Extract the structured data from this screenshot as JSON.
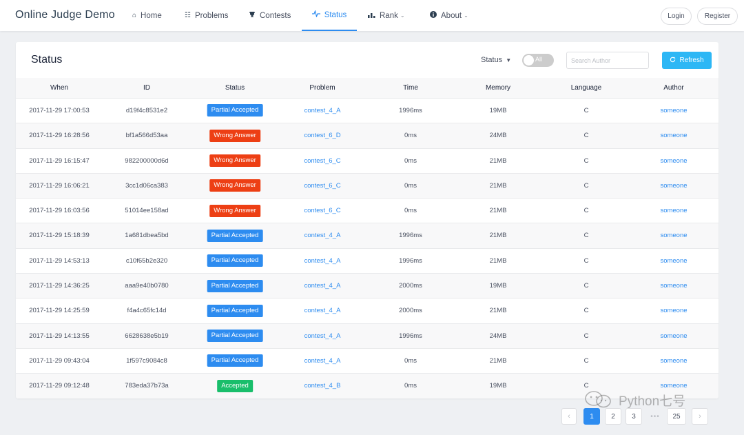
{
  "navbar": {
    "brand": "Online Judge Demo",
    "items": [
      {
        "icon": "home-icon",
        "glyph": "⌂",
        "label": "Home",
        "dropdown": false
      },
      {
        "icon": "grid-icon",
        "glyph": "☷",
        "label": "Problems",
        "dropdown": false
      },
      {
        "icon": "trophy-icon",
        "glyph": "🏆",
        "label": "Contests",
        "dropdown": false
      },
      {
        "icon": "pulse-icon",
        "glyph": "〜",
        "label": "Status",
        "dropdown": false,
        "active": true
      },
      {
        "icon": "bar-chart-icon",
        "glyph": "▂▄",
        "label": "Rank",
        "dropdown": true
      },
      {
        "icon": "info-icon",
        "glyph": "ℹ",
        "label": "About",
        "dropdown": true
      }
    ],
    "login_label": "Login",
    "register_label": "Register"
  },
  "card": {
    "title": "Status",
    "status_filter_label": "Status",
    "toggle_label": "All",
    "search_placeholder": "Search Author",
    "refresh_label": "Refresh"
  },
  "table": {
    "columns": [
      "When",
      "ID",
      "Status",
      "Problem",
      "Time",
      "Memory",
      "Language",
      "Author"
    ],
    "rows": [
      {
        "when": "2017-11-29 17:00:53",
        "id": "d19f4c8531e2",
        "status": "Partial Accepted",
        "status_color": "blue",
        "problem": "contest_4_A",
        "time": "1996ms",
        "memory": "19MB",
        "language": "C",
        "author": "someone"
      },
      {
        "when": "2017-11-29 16:28:56",
        "id": "bf1a566d53aa",
        "status": "Wrong Answer",
        "status_color": "red",
        "problem": "contest_6_D",
        "time": "0ms",
        "memory": "24MB",
        "language": "C",
        "author": "someone"
      },
      {
        "when": "2017-11-29 16:15:47",
        "id": "982200000d6d",
        "status": "Wrong Answer",
        "status_color": "red",
        "problem": "contest_6_C",
        "time": "0ms",
        "memory": "21MB",
        "language": "C",
        "author": "someone"
      },
      {
        "when": "2017-11-29 16:06:21",
        "id": "3cc1d06ca383",
        "status": "Wrong Answer",
        "status_color": "red",
        "problem": "contest_6_C",
        "time": "0ms",
        "memory": "21MB",
        "language": "C",
        "author": "someone"
      },
      {
        "when": "2017-11-29 16:03:56",
        "id": "51014ee158ad",
        "status": "Wrong Answer",
        "status_color": "red",
        "problem": "contest_6_C",
        "time": "0ms",
        "memory": "21MB",
        "language": "C",
        "author": "someone"
      },
      {
        "when": "2017-11-29 15:18:39",
        "id": "1a681dbea5bd",
        "status": "Partial Accepted",
        "status_color": "blue",
        "problem": "contest_4_A",
        "time": "1996ms",
        "memory": "21MB",
        "language": "C",
        "author": "someone"
      },
      {
        "when": "2017-11-29 14:53:13",
        "id": "c10f65b2e320",
        "status": "Partial Accepted",
        "status_color": "blue",
        "problem": "contest_4_A",
        "time": "1996ms",
        "memory": "21MB",
        "language": "C",
        "author": "someone"
      },
      {
        "when": "2017-11-29 14:36:25",
        "id": "aaa9e40b0780",
        "status": "Partial Accepted",
        "status_color": "blue",
        "problem": "contest_4_A",
        "time": "2000ms",
        "memory": "19MB",
        "language": "C",
        "author": "someone"
      },
      {
        "when": "2017-11-29 14:25:59",
        "id": "f4a4c65fc14d",
        "status": "Partial Accepted",
        "status_color": "blue",
        "problem": "contest_4_A",
        "time": "2000ms",
        "memory": "21MB",
        "language": "C",
        "author": "someone"
      },
      {
        "when": "2017-11-29 14:13:55",
        "id": "6628638e5b19",
        "status": "Partial Accepted",
        "status_color": "blue",
        "problem": "contest_4_A",
        "time": "1996ms",
        "memory": "24MB",
        "language": "C",
        "author": "someone"
      },
      {
        "when": "2017-11-29 09:43:04",
        "id": "1f597c9084c8",
        "status": "Partial Accepted",
        "status_color": "blue",
        "problem": "contest_4_A",
        "time": "0ms",
        "memory": "21MB",
        "language": "C",
        "author": "someone"
      },
      {
        "when": "2017-11-29 09:12:48",
        "id": "783eda37b73a",
        "status": "Accepted",
        "status_color": "green",
        "problem": "contest_4_B",
        "time": "0ms",
        "memory": "19MB",
        "language": "C",
        "author": "someone"
      }
    ]
  },
  "pagination": {
    "prev": "‹",
    "pages": [
      "1",
      "2",
      "3"
    ],
    "ellipsis": "•••",
    "last": "25",
    "next": "›",
    "current": "1"
  },
  "watermark": {
    "text": "Python七号"
  },
  "colors": {
    "primary": "#2d8cf0",
    "info": "#2db7f5",
    "error": "#ed3f14",
    "success": "#19be6b"
  }
}
